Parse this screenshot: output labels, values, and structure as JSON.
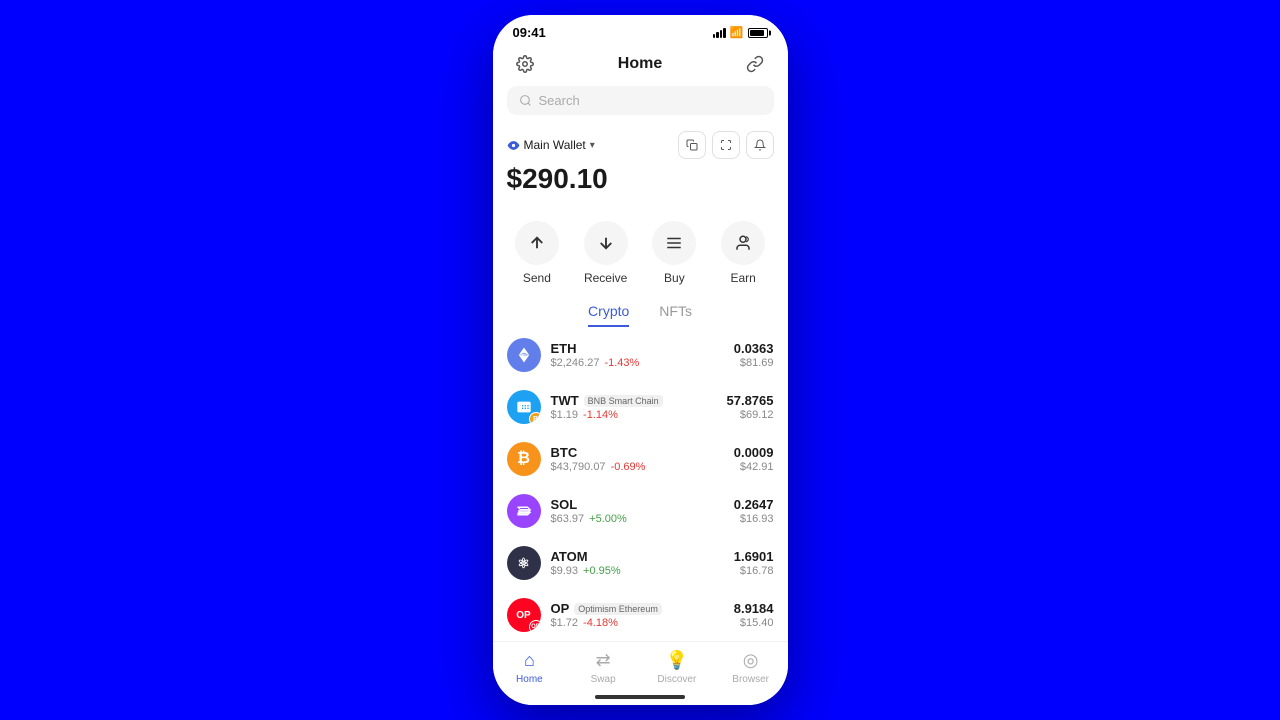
{
  "statusBar": {
    "time": "09:41"
  },
  "header": {
    "title": "Home"
  },
  "search": {
    "placeholder": "Search"
  },
  "wallet": {
    "name": "Main Wallet",
    "balance": "$290.10"
  },
  "actions": [
    {
      "id": "send",
      "label": "Send",
      "icon": "↑"
    },
    {
      "id": "receive",
      "label": "Receive",
      "icon": "↓"
    },
    {
      "id": "buy",
      "label": "Buy",
      "icon": "≡"
    },
    {
      "id": "earn",
      "label": "Earn",
      "icon": "👤"
    }
  ],
  "tabs": [
    {
      "id": "crypto",
      "label": "Crypto",
      "active": true
    },
    {
      "id": "nfts",
      "label": "NFTs",
      "active": false
    }
  ],
  "cryptoList": [
    {
      "symbol": "ETH",
      "chain": "",
      "price": "$2,246.27",
      "change": "-1.43%",
      "changeType": "negative",
      "amount": "0.0363",
      "usdValue": "$81.69",
      "logoColor": "#627eea",
      "logoText": "Ξ"
    },
    {
      "symbol": "TWT",
      "chain": "BNB Smart Chain",
      "price": "$1.19",
      "change": "-1.14%",
      "changeType": "negative",
      "amount": "57.8765",
      "usdValue": "$69.12",
      "logoColor": "#1da1f2",
      "logoText": "T"
    },
    {
      "symbol": "BTC",
      "chain": "",
      "price": "$43,790.07",
      "change": "-0.69%",
      "changeType": "negative",
      "amount": "0.0009",
      "usdValue": "$42.91",
      "logoColor": "#f7931a",
      "logoText": "₿"
    },
    {
      "symbol": "SOL",
      "chain": "",
      "price": "$63.97",
      "change": "+5.00%",
      "changeType": "positive",
      "amount": "0.2647",
      "usdValue": "$16.93",
      "logoColor": "#9945ff",
      "logoText": "◎"
    },
    {
      "symbol": "ATOM",
      "chain": "",
      "price": "$9.93",
      "change": "+0.95%",
      "changeType": "positive",
      "amount": "1.6901",
      "usdValue": "$16.78",
      "logoColor": "#2e3148",
      "logoText": "⚛"
    },
    {
      "symbol": "OP",
      "chain": "Optimism Ethereum",
      "price": "$1.72",
      "change": "-4.18%",
      "changeType": "negative",
      "amount": "8.9184",
      "usdValue": "$15.40",
      "logoColor": "#ff0420",
      "logoText": "OP"
    }
  ],
  "bottomNav": [
    {
      "id": "home",
      "label": "Home",
      "icon": "⌂",
      "active": true
    },
    {
      "id": "swap",
      "label": "Swap",
      "icon": "⇄",
      "active": false
    },
    {
      "id": "discover",
      "label": "Discover",
      "icon": "💡",
      "active": false
    },
    {
      "id": "browser",
      "label": "Browser",
      "icon": "◉",
      "active": false
    }
  ]
}
